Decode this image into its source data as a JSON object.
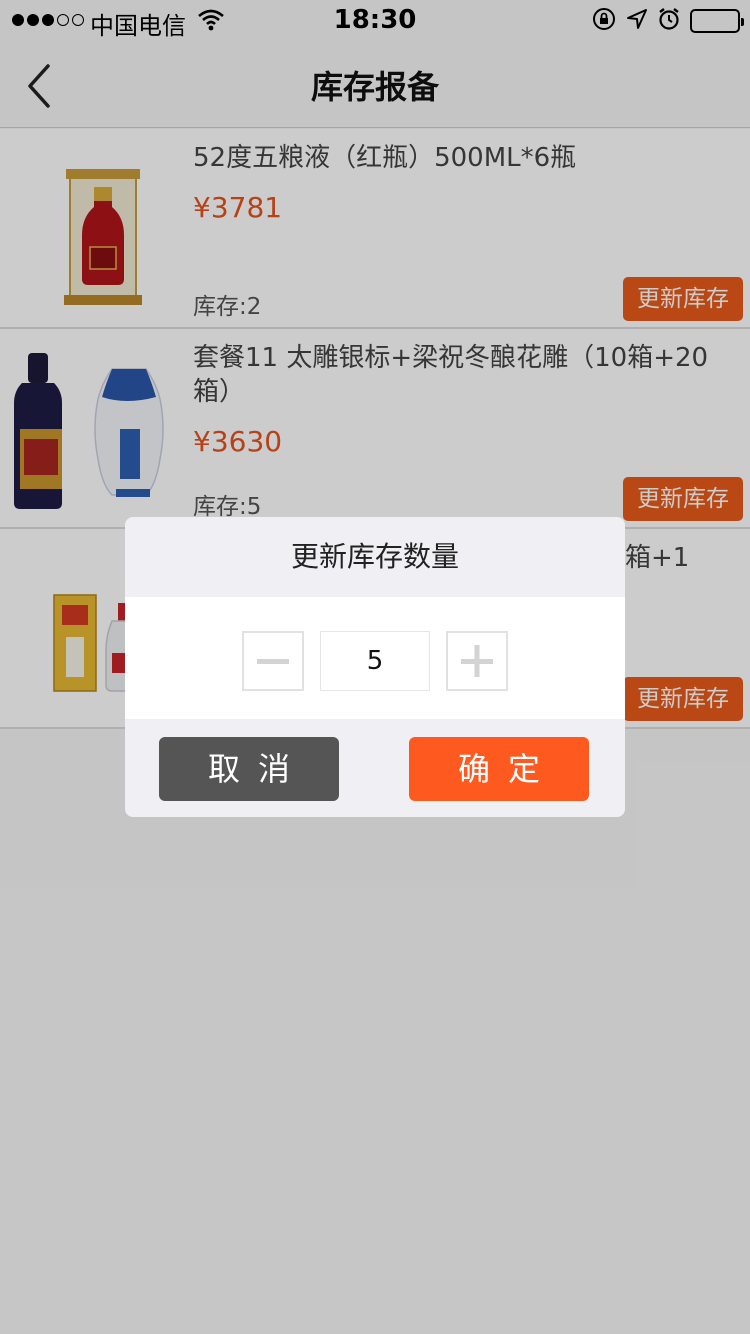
{
  "status_bar": {
    "carrier": "中国电信",
    "time": "18:30"
  },
  "nav": {
    "title": "库存报备"
  },
  "items": [
    {
      "name": "52度五粮液（红瓶）500ML*6瓶",
      "price": "¥3781",
      "stock": "库存:2",
      "button": "更新库存"
    },
    {
      "name": "套餐11 太雕银标+梁祝冬酿花雕（10箱+20箱）",
      "price": "¥3630",
      "stock": "库存:5",
      "button": "更新库存"
    },
    {
      "name": "箱+1",
      "button": "更新库存"
    }
  ],
  "dialog": {
    "title": "更新库存数量",
    "quantity": "5",
    "cancel": "取消",
    "confirm": "确定"
  },
  "colors": {
    "accent": "#e85a1a",
    "price": "#e4531f",
    "confirm": "#fe5a1f",
    "cancel": "#555555"
  }
}
